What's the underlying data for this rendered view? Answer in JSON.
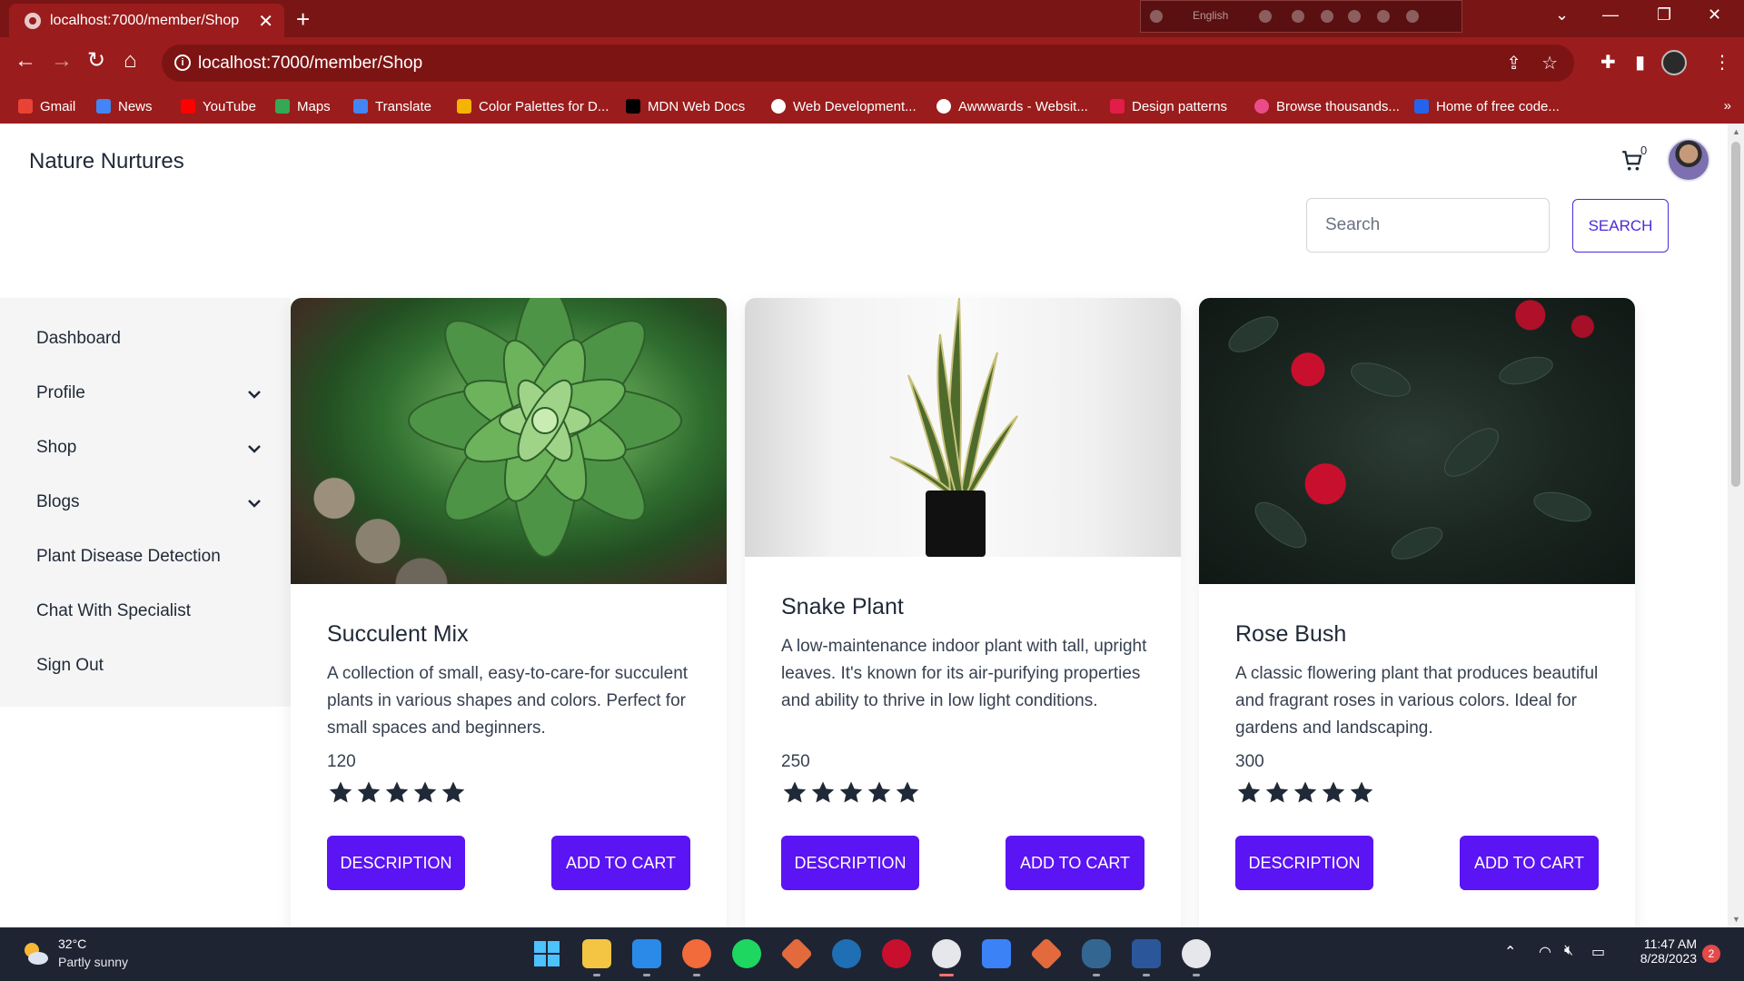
{
  "browser": {
    "tab_title": "localhost:7000/member/Shop",
    "url": "localhost:7000/member/Shop",
    "language_label": "English",
    "bookmarks": [
      {
        "label": "Gmail",
        "color": "#ea4335"
      },
      {
        "label": "News",
        "color": "#4285f4"
      },
      {
        "label": "YouTube",
        "color": "#ff0000"
      },
      {
        "label": "Maps",
        "color": "#34a853"
      },
      {
        "label": "Translate",
        "color": "#4285f4"
      },
      {
        "label": "Color Palettes for D...",
        "color": "#f4b400"
      },
      {
        "label": "MDN Web Docs",
        "color": "#000000"
      },
      {
        "label": "Web Development...",
        "color": "#ffffff"
      },
      {
        "label": "Awwwards - Websit...",
        "color": "#ffffff"
      },
      {
        "label": "Design patterns",
        "color": "#e11d48"
      },
      {
        "label": "Browse thousands...",
        "color": "#ea4c89"
      },
      {
        "label": "Home of free code...",
        "color": "#2563eb"
      }
    ],
    "more_bookmarks": "»"
  },
  "header": {
    "brand": "Nature Nurtures",
    "cart_count": "0",
    "search_placeholder": "Search",
    "search_button": "SEARCH"
  },
  "sidebar": {
    "items": [
      {
        "label": "Dashboard",
        "has_chevron": false
      },
      {
        "label": "Profile",
        "has_chevron": true
      },
      {
        "label": "Shop",
        "has_chevron": true
      },
      {
        "label": "Blogs",
        "has_chevron": true
      },
      {
        "label": "Plant Disease Detection",
        "has_chevron": false
      },
      {
        "label": "Chat With Specialist",
        "has_chevron": false
      },
      {
        "label": "Sign Out",
        "has_chevron": false
      }
    ]
  },
  "products": [
    {
      "title": "Succulent Mix",
      "description": "A collection of small, easy-to-care-for succulent plants in various shapes and colors. Perfect for small spaces and beginners.",
      "price": "120",
      "rating": 5,
      "description_button": "DESCRIPTION",
      "cart_button": "ADD TO CART"
    },
    {
      "title": "Snake Plant",
      "description": "A low-maintenance indoor plant with tall, upright leaves. It's known for its air-purifying properties and ability to thrive in low light conditions.",
      "price": "250",
      "rating": 5,
      "description_button": "DESCRIPTION",
      "cart_button": "ADD TO CART"
    },
    {
      "title": "Rose Bush",
      "description": "A classic flowering plant that produces beautiful and fragrant roses in various colors. Ideal for gardens and landscaping.",
      "price": "300",
      "rating": 5,
      "description_button": "DESCRIPTION",
      "cart_button": "ADD TO CART"
    }
  ],
  "taskbar": {
    "temperature": "32°C",
    "condition": "Partly sunny",
    "time": "11:47 AM",
    "date": "8/28/2023",
    "notifications": "2"
  },
  "colors": {
    "accent": "#5b14f3",
    "browser_frame": "#9b1c1c",
    "text_dark": "#1f2937"
  }
}
